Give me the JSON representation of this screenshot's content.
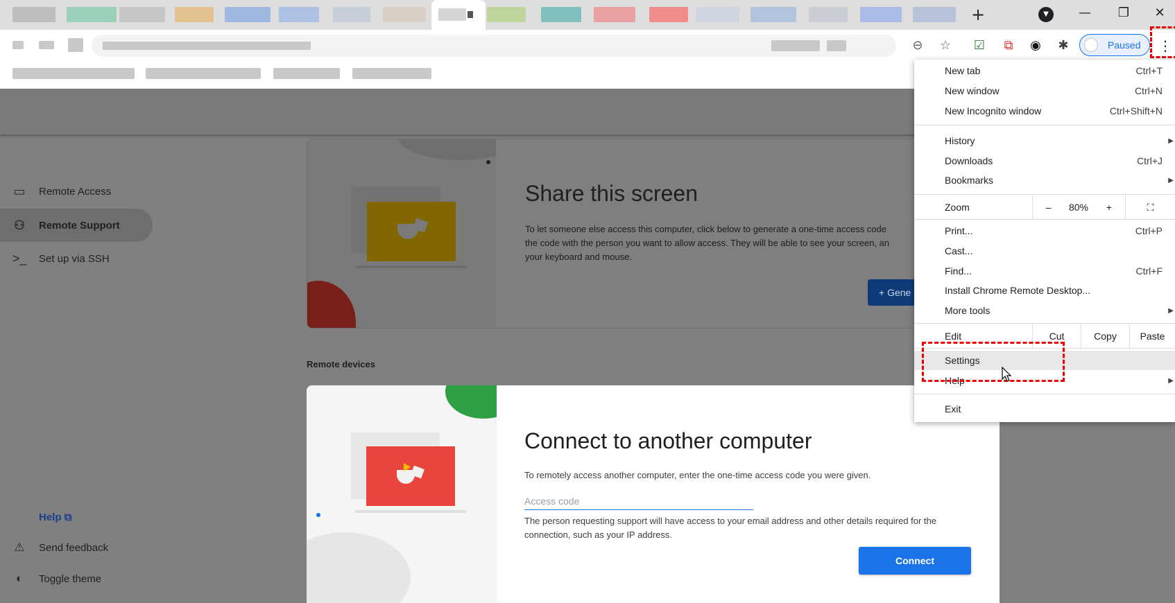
{
  "browser": {
    "profile_status": "Paused",
    "new_tab_icon": "plus-icon",
    "tab_search_icon": "chevron-down-circle-icon",
    "window_controls": [
      "minimize-icon",
      "restore-icon",
      "close-icon"
    ]
  },
  "sidebar": {
    "items": [
      {
        "label": "Remote Access",
        "icon": "laptop-icon"
      },
      {
        "label": "Remote Support",
        "icon": "people-icon"
      },
      {
        "label": "Set up via SSH",
        "icon": "terminal-icon"
      }
    ],
    "help": "Help",
    "send_feedback": "Send feedback",
    "toggle_theme": "Toggle theme"
  },
  "share_card": {
    "title": "Share this screen",
    "description_line1": "To let someone else access this computer, click below to generate a one-time access code",
    "description_line2": "the code with the person you want to allow access. They will be able to see your screen, an",
    "description_line3": "your keyboard and mouse.",
    "button": "+ Gene"
  },
  "remote_devices_label": "Remote devices",
  "connect_card": {
    "title": "Connect to another computer",
    "description": "To remotely access another computer, enter the one-time access code you were given.",
    "input_placeholder": "Access code",
    "note_line1": "The person requesting support will have access to your email address and other details required for the",
    "note_line2": "connection, such as your IP address.",
    "button": "Connect"
  },
  "menu": {
    "new_tab": {
      "label": "New tab",
      "shortcut": "Ctrl+T"
    },
    "new_window": {
      "label": "New window",
      "shortcut": "Ctrl+N"
    },
    "new_incognito": {
      "label": "New Incognito window",
      "shortcut": "Ctrl+Shift+N"
    },
    "history": {
      "label": "History"
    },
    "downloads": {
      "label": "Downloads",
      "shortcut": "Ctrl+J"
    },
    "bookmarks": {
      "label": "Bookmarks"
    },
    "zoom": {
      "label": "Zoom",
      "minus": "–",
      "level": "80%",
      "plus": "+"
    },
    "print": {
      "label": "Print...",
      "shortcut": "Ctrl+P"
    },
    "cast": {
      "label": "Cast..."
    },
    "find": {
      "label": "Find...",
      "shortcut": "Ctrl+F"
    },
    "install": {
      "label": "Install Chrome Remote Desktop..."
    },
    "more_tools": {
      "label": "More tools"
    },
    "edit": {
      "label": "Edit",
      "cut": "Cut",
      "copy": "Copy",
      "paste": "Paste"
    },
    "settings": {
      "label": "Settings"
    },
    "help": {
      "label": "Help"
    },
    "exit": {
      "label": "Exit"
    }
  },
  "colors": {
    "accent": "#1a73e8",
    "highlight": "#e00000"
  }
}
